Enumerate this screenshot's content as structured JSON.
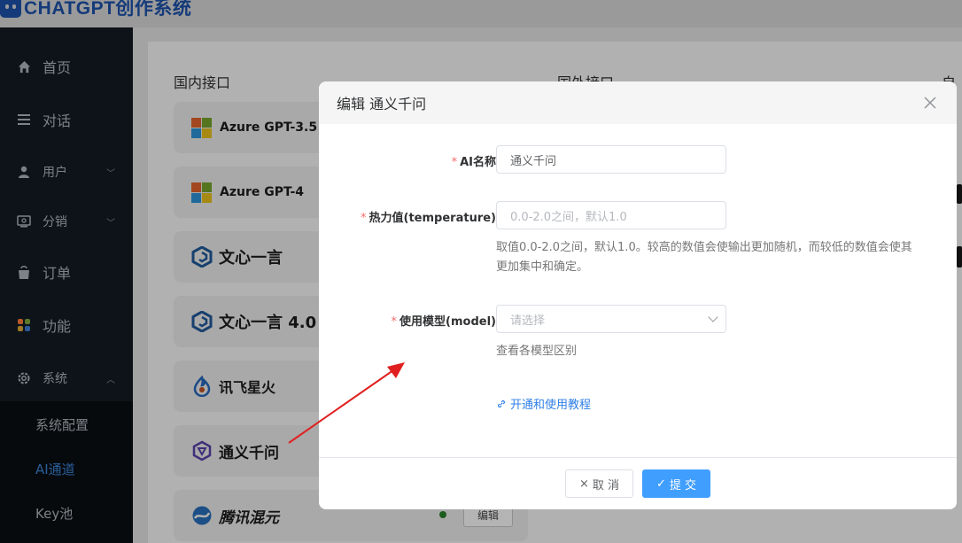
{
  "app": {
    "title": "CHATGPT创作系统"
  },
  "sidebar": {
    "items": [
      {
        "label": "首页",
        "icon": "home-icon"
      },
      {
        "label": "对话",
        "icon": "menu-icon"
      },
      {
        "label": "用户",
        "icon": "user-icon"
      },
      {
        "label": "分销",
        "icon": "distribution-icon"
      },
      {
        "label": "订单",
        "icon": "order-icon"
      },
      {
        "label": "功能",
        "icon": "apps-icon"
      },
      {
        "label": "系统",
        "icon": "gear-icon"
      }
    ],
    "submenu": [
      {
        "label": "系统配置"
      },
      {
        "label": "AI通道"
      },
      {
        "label": "Key池"
      }
    ]
  },
  "main": {
    "columns": [
      {
        "title": "国内接口"
      },
      {
        "title": "国外接口"
      },
      {
        "title": "自部"
      }
    ],
    "cards": [
      {
        "name": "Azure GPT-3.5",
        "logo": "microsoft-logo"
      },
      {
        "name": "Azure GPT-4",
        "logo": "microsoft-logo"
      },
      {
        "name": "文心一言",
        "logo": "wenxin-logo"
      },
      {
        "name": "文心一言 4.0",
        "logo": "wenxin-logo"
      },
      {
        "name": "讯飞星火",
        "logo": "xunfei-logo"
      },
      {
        "name": "通义千问",
        "logo": "tongyi-logo"
      },
      {
        "name": "腾讯混元",
        "logo": "hunyuan-logo",
        "edit_label": "编辑"
      }
    ]
  },
  "modal": {
    "title": "编辑 通义千问",
    "fields": {
      "ai_name": {
        "label": "AI名称",
        "value": "通义千问"
      },
      "temperature": {
        "label": "热力值(temperature)",
        "placeholder": "0.0-2.0之间，默认1.0",
        "hint_line1": "取值0.0-2.0之间，默认1.0。较高的数值会使输出更加随机，而较低的数值会使其",
        "hint_line2": "更加集中和确定。"
      },
      "model": {
        "label": "使用模型(model)",
        "placeholder": "请选择",
        "hint": "查看各模型区别"
      }
    },
    "tutorial_link": "开通和使用教程",
    "cancel_label": "取 消",
    "submit_label": "提 交"
  },
  "colors": {
    "primary": "#409eff",
    "required": "#f56c6c",
    "link": "#2f7fe6",
    "annotation": "#e02020"
  }
}
